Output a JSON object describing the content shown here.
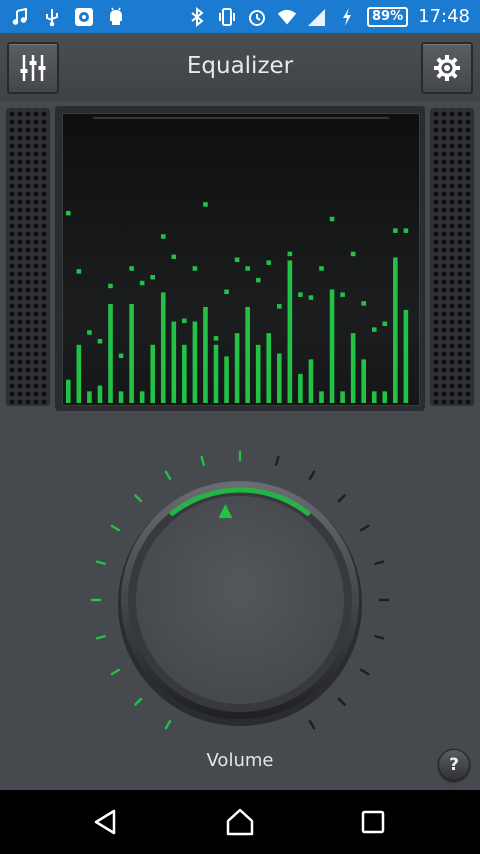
{
  "status_bar": {
    "left_icons": [
      "music-note-icon",
      "usb-icon",
      "app-notification-icon",
      "android-debug-icon"
    ],
    "right_icons": [
      "bluetooth-icon",
      "vibrate-icon",
      "alarm-icon",
      "wifi-icon",
      "signal-icon",
      "charging-icon"
    ],
    "battery_text": "89%",
    "time": "17:48",
    "color": "#1a7bd0"
  },
  "app_bar": {
    "title": "Equalizer",
    "left_icon": "equalizer-sliders-icon",
    "right_icon": "settings-gear-icon"
  },
  "visualizer": {
    "bar_color": "#22c247",
    "bars": [
      {
        "level": 0.08,
        "peak": 0.66
      },
      {
        "level": 0.2,
        "peak": 0.46
      },
      {
        "level": 0.04,
        "peak": 0.25
      },
      {
        "level": 0.06,
        "peak": 0.22
      },
      {
        "level": 0.34,
        "peak": 0.41
      },
      {
        "level": 0.04,
        "peak": 0.17
      },
      {
        "level": 0.34,
        "peak": 0.47
      },
      {
        "level": 0.04,
        "peak": 0.42
      },
      {
        "level": 0.2,
        "peak": 0.44
      },
      {
        "level": 0.38,
        "peak": 0.58
      },
      {
        "level": 0.28,
        "peak": 0.51
      },
      {
        "level": 0.2,
        "peak": 0.29
      },
      {
        "level": 0.28,
        "peak": 0.47
      },
      {
        "level": 0.33,
        "peak": 0.69
      },
      {
        "level": 0.2,
        "peak": 0.23
      },
      {
        "level": 0.16,
        "peak": 0.39
      },
      {
        "level": 0.24,
        "peak": 0.5
      },
      {
        "level": 0.33,
        "peak": 0.47
      },
      {
        "level": 0.2,
        "peak": 0.43
      },
      {
        "level": 0.24,
        "peak": 0.49
      },
      {
        "level": 0.17,
        "peak": 0.34
      },
      {
        "level": 0.49,
        "peak": 0.52
      },
      {
        "level": 0.1,
        "peak": 0.38
      },
      {
        "level": 0.15,
        "peak": 0.37
      },
      {
        "level": 0.04,
        "peak": 0.47
      },
      {
        "level": 0.39,
        "peak": 0.64
      },
      {
        "level": 0.04,
        "peak": 0.38
      },
      {
        "level": 0.24,
        "peak": 0.52
      },
      {
        "level": 0.15,
        "peak": 0.35
      },
      {
        "level": 0.04,
        "peak": 0.26
      },
      {
        "level": 0.04,
        "peak": 0.28
      },
      {
        "level": 0.5,
        "peak": 0.6
      },
      {
        "level": 0.32,
        "peak": 0.6
      }
    ]
  },
  "dial": {
    "label": "Volume",
    "level": 0.5,
    "accent": "#22c247"
  },
  "help": {
    "label": "?"
  },
  "nav_bar": {
    "back_icon": "back-triangle-icon",
    "home_icon": "home-icon",
    "recents_icon": "recents-square-icon"
  }
}
